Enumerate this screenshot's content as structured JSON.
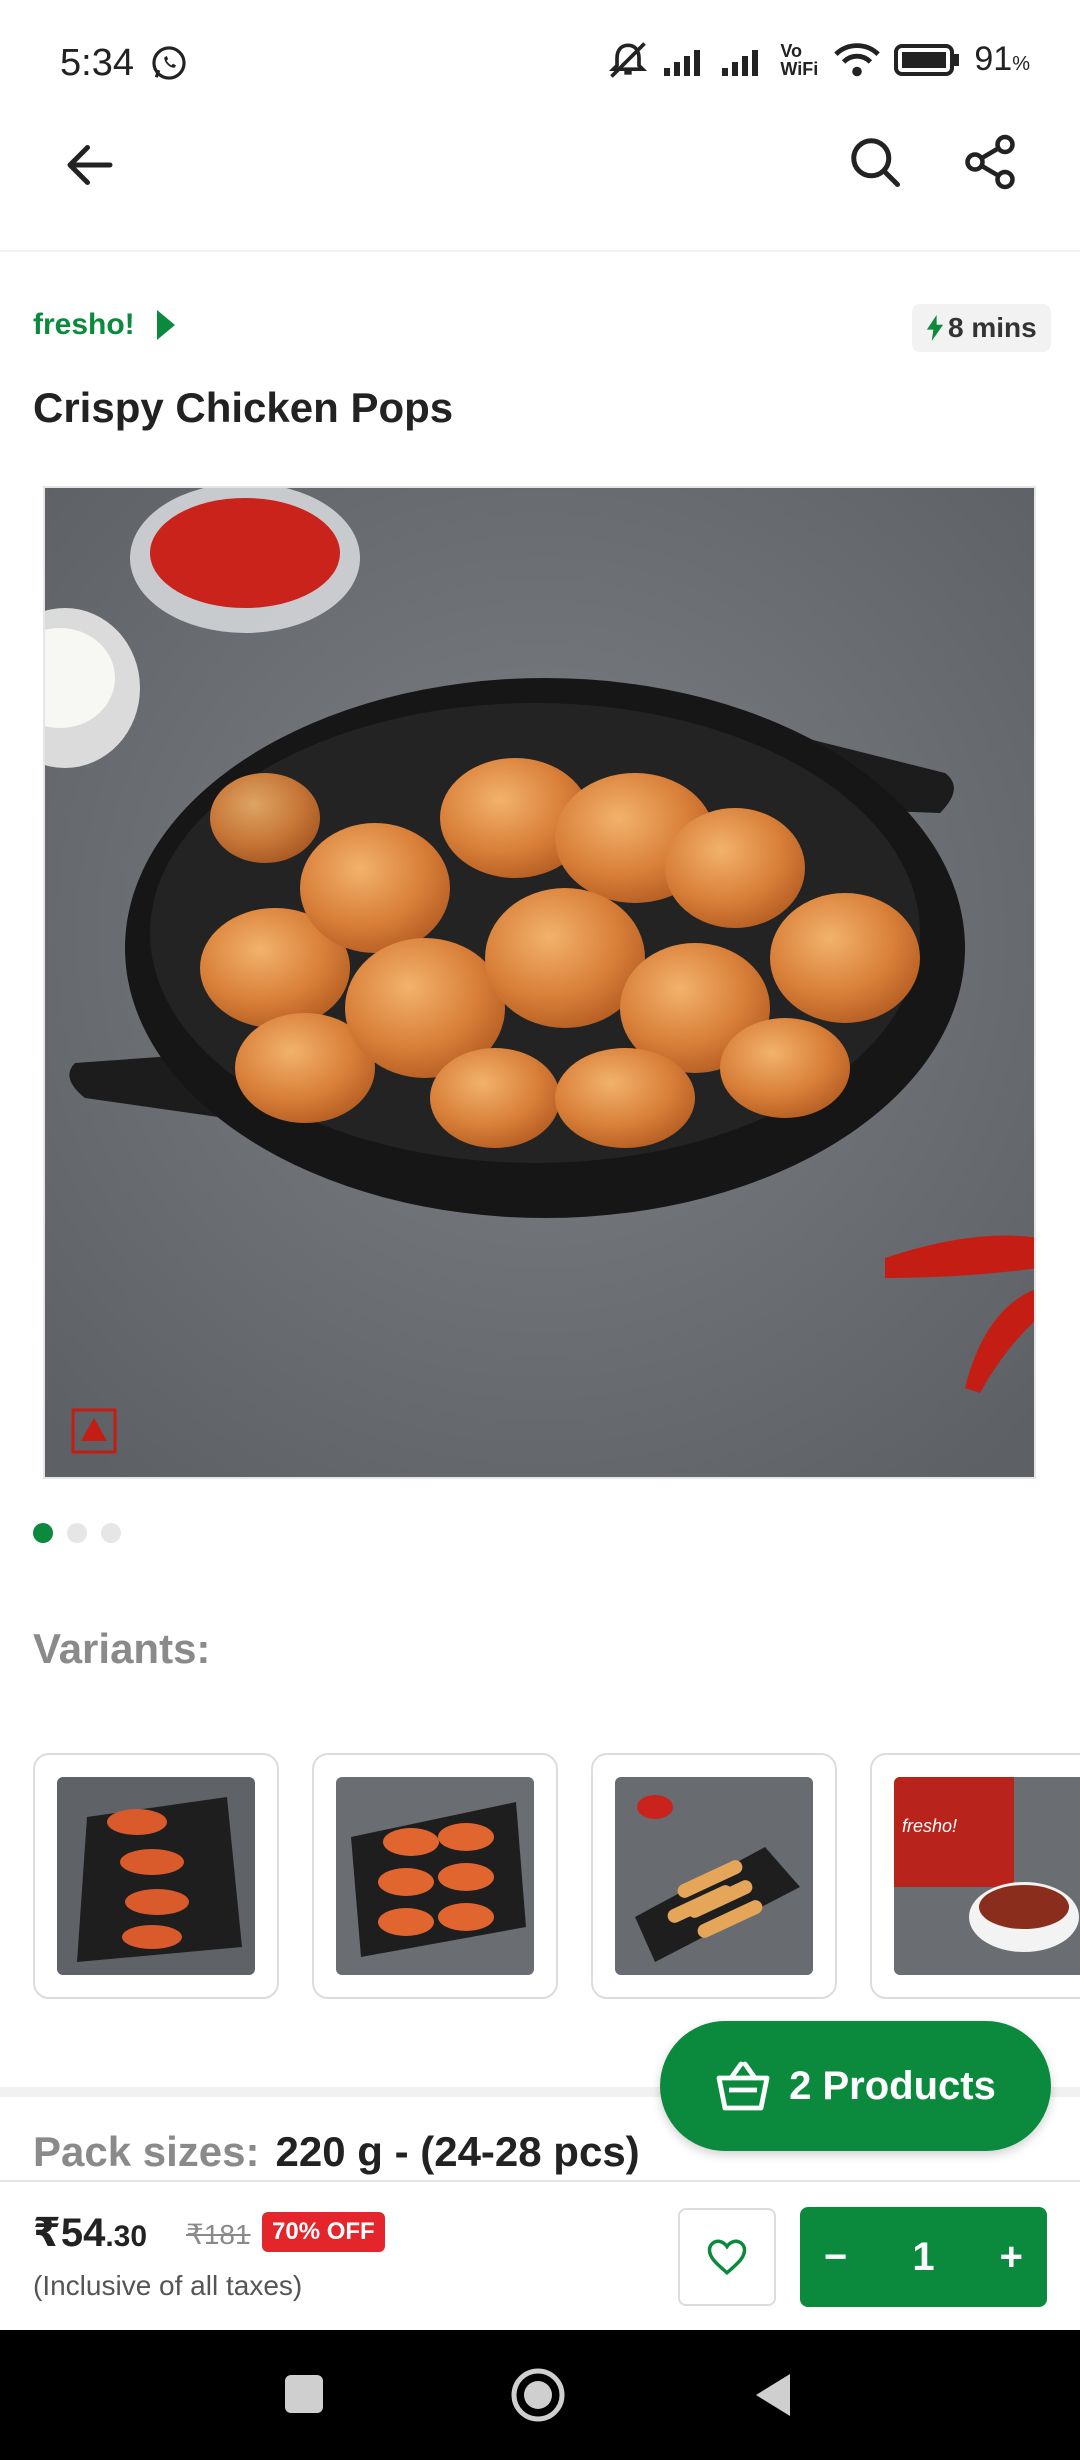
{
  "status_bar": {
    "time": "5:34",
    "battery": "91",
    "battery_unit": "%",
    "network_label": "Vo WiFi"
  },
  "header": {
    "back_icon": "arrow-left-icon",
    "search_icon": "search-icon",
    "share_icon": "share-icon"
  },
  "product": {
    "brand": "fresho!",
    "eta": "8 mins",
    "title": "Crispy Chicken Pops",
    "image_count": 3,
    "active_image_index": 0
  },
  "variants": {
    "label": "Variants:",
    "count": 4
  },
  "pack": {
    "label": "Pack sizes:",
    "value": "220 g - (24-28 pcs)"
  },
  "cart": {
    "label": "2 Products",
    "icon": "basket-icon"
  },
  "price": {
    "currency": "₹",
    "whole": "54",
    "cents": ".30",
    "mrp": "₹181",
    "discount": "70% OFF",
    "tax_note": "(Inclusive of all taxes)"
  },
  "quantity": {
    "minus": "−",
    "value": "1",
    "plus": "+"
  },
  "colors": {
    "brand_green": "#0b8a3e",
    "discount_red": "#e4252c"
  }
}
